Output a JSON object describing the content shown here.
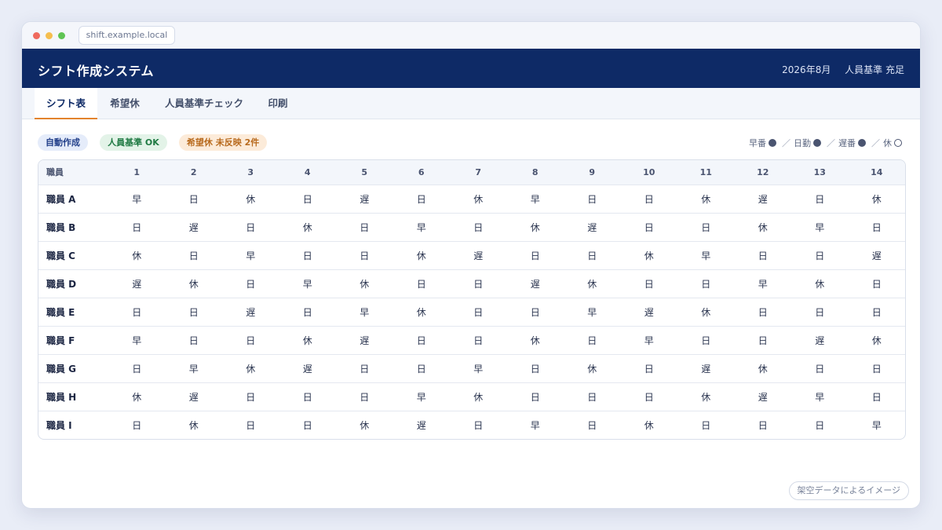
{
  "browser": {
    "url": "shift.example.local"
  },
  "header": {
    "title": "シフト作成システム",
    "month": "2026年8月",
    "status": "人員基準 充足"
  },
  "tabs": [
    "シフト表",
    "希望休",
    "人員基準チェック",
    "印刷"
  ],
  "active_tab": 0,
  "badges": [
    "自動作成",
    "人員基準 OK",
    "希望休 未反映 2件"
  ],
  "legend": {
    "early": "早番",
    "day": "日勤",
    "late": "遅番",
    "off": "休"
  },
  "table": {
    "name_header": "職員",
    "days": [
      "1",
      "2",
      "3",
      "4",
      "5",
      "6",
      "7",
      "8",
      "9",
      "10",
      "11",
      "12",
      "13",
      "14"
    ],
    "rows": [
      {
        "name": "職員 A",
        "shifts": [
          "早",
          "日",
          "休",
          "日",
          "遅",
          "日",
          "休",
          "早",
          "日",
          "日",
          "休",
          "遅",
          "日",
          "休"
        ]
      },
      {
        "name": "職員 B",
        "shifts": [
          "日",
          "遅",
          "日",
          "休",
          "日",
          "早",
          "日",
          "休",
          "遅",
          "日",
          "日",
          "休",
          "早",
          "日"
        ]
      },
      {
        "name": "職員 C",
        "shifts": [
          "休",
          "日",
          "早",
          "日",
          "日",
          "休",
          "遅",
          "日",
          "日",
          "休",
          "早",
          "日",
          "日",
          "遅"
        ]
      },
      {
        "name": "職員 D",
        "shifts": [
          "遅",
          "休",
          "日",
          "早",
          "休",
          "日",
          "日",
          "遅",
          "休",
          "日",
          "日",
          "早",
          "休",
          "日"
        ]
      },
      {
        "name": "職員 E",
        "shifts": [
          "日",
          "日",
          "遅",
          "日",
          "早",
          "休",
          "日",
          "日",
          "早",
          "遅",
          "休",
          "日",
          "日",
          "日"
        ]
      },
      {
        "name": "職員 F",
        "shifts": [
          "早",
          "日",
          "日",
          "休",
          "遅",
          "日",
          "日",
          "休",
          "日",
          "早",
          "日",
          "日",
          "遅",
          "休"
        ]
      },
      {
        "name": "職員 G",
        "shifts": [
          "日",
          "早",
          "休",
          "遅",
          "日",
          "日",
          "早",
          "日",
          "休",
          "日",
          "遅",
          "休",
          "日",
          "日"
        ]
      },
      {
        "name": "職員 H",
        "shifts": [
          "休",
          "遅",
          "日",
          "日",
          "日",
          "早",
          "休",
          "日",
          "日",
          "日",
          "休",
          "遅",
          "早",
          "日"
        ]
      },
      {
        "name": "職員 I",
        "shifts": [
          "日",
          "休",
          "日",
          "日",
          "休",
          "遅",
          "日",
          "早",
          "日",
          "休",
          "日",
          "日",
          "日",
          "早"
        ]
      }
    ]
  },
  "footer_note": "架空データによるイメージ"
}
